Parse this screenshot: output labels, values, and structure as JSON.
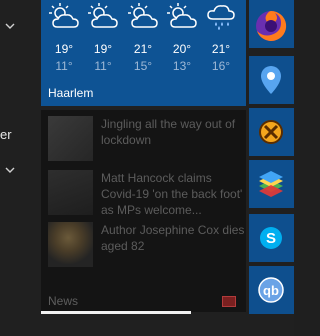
{
  "left_menu": {
    "partial_text": "er"
  },
  "weather": {
    "city": "Haarlem",
    "days": [
      {
        "icon": "sun-cloud-icon",
        "high": "19°",
        "low": "11°"
      },
      {
        "icon": "sun-cloud-icon",
        "high": "19°",
        "low": "11°"
      },
      {
        "icon": "sun-cloud-icon",
        "high": "21°",
        "low": "15°"
      },
      {
        "icon": "sun-cloud-icon",
        "high": "20°",
        "low": "13°"
      },
      {
        "icon": "rain-cloud-icon",
        "high": "21°",
        "low": "16°"
      }
    ]
  },
  "news": {
    "label": "News",
    "items": [
      {
        "headline": "Jingling all the way out of lockdown"
      },
      {
        "headline": "Matt Hancock claims Covid-19 'on the back foot' as MPs welcome..."
      },
      {
        "headline": "Author Josephine Cox dies aged 82"
      }
    ],
    "progress": 0.73
  },
  "apps": [
    {
      "name": "Firefox",
      "icon": "firefox-icon",
      "color": "#e66000"
    },
    {
      "name": "Maps",
      "icon": "maps-pin-icon",
      "color": "#3a7bd5"
    },
    {
      "name": "Pie",
      "icon": "pie-icon",
      "color": "#f0a020"
    },
    {
      "name": "BlueStacks",
      "icon": "bluestacks-icon",
      "color": "#4caf50"
    },
    {
      "name": "Skype",
      "icon": "skype-icon",
      "color": "#00aff0"
    },
    {
      "name": "qBittorrent",
      "icon": "qbittorrent-icon",
      "color": "#3b78c2"
    }
  ],
  "colors": {
    "weather_tile": "#0e5394",
    "news_tile": "#141414",
    "background": "#202020"
  }
}
